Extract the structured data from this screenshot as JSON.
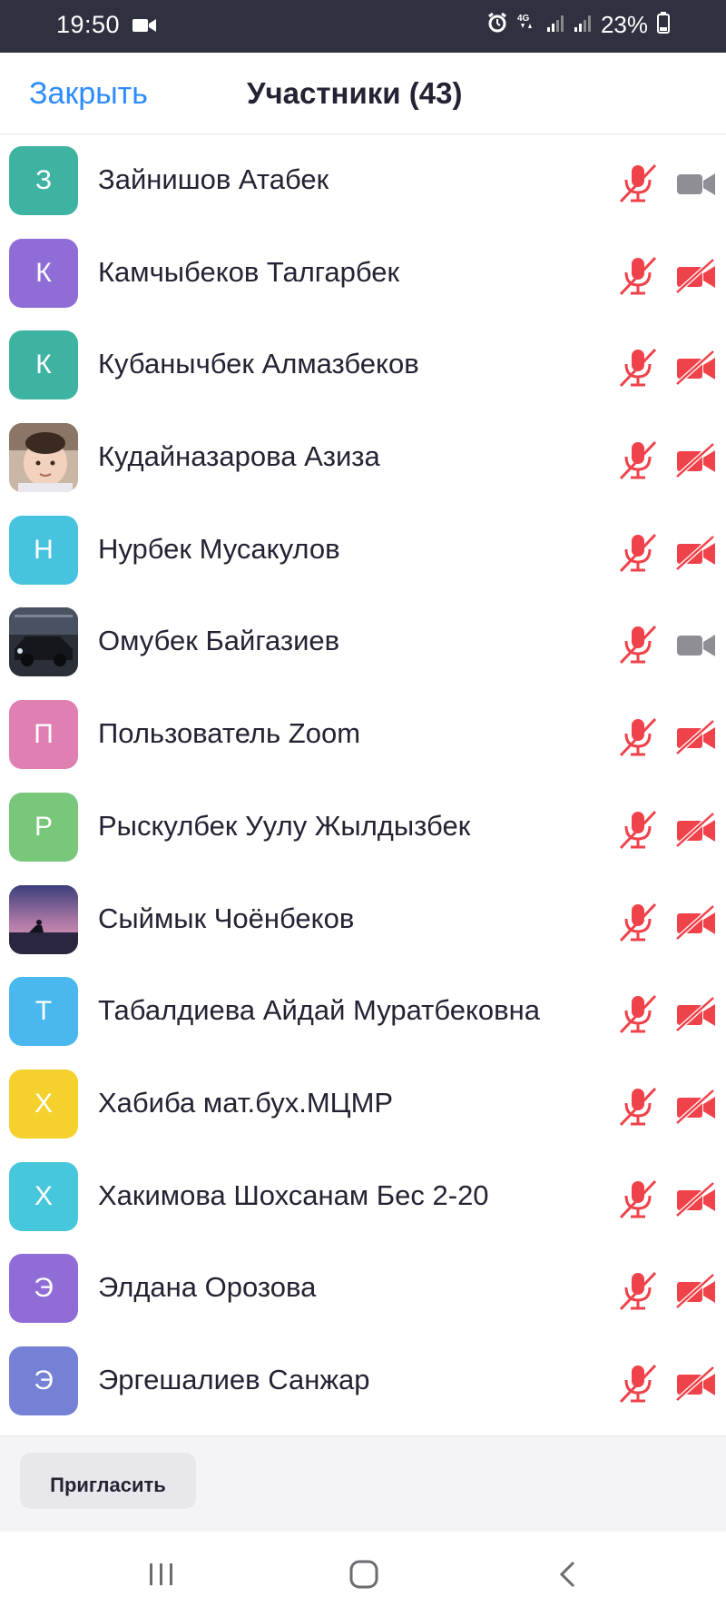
{
  "status_bar": {
    "time": "19:50",
    "battery": "23%",
    "icons": [
      "video-camera-icon",
      "alarm-icon",
      "4g-icon",
      "signal-icon",
      "signal-icon",
      "battery-icon"
    ]
  },
  "header": {
    "close_label": "Закрыть",
    "title": "Участники (43)"
  },
  "colors": {
    "accent": "#2d8cff",
    "muted_red": "#f0424a",
    "video_gray": "#8e8e94",
    "status_bar_bg": "#2f3140"
  },
  "participants": [
    {
      "initial": "З",
      "name": "Зайнишов Атабек",
      "avatar_color": "#3fb3a2",
      "avatar_type": "letter",
      "mic": "muted",
      "video": "on"
    },
    {
      "initial": "К",
      "name": "Камчыбеков Талгарбек",
      "avatar_color": "#8f6cd6",
      "avatar_type": "letter",
      "mic": "muted",
      "video": "off"
    },
    {
      "initial": "К",
      "name": "Кубанычбек Алмазбеков",
      "avatar_color": "#3fb3a2",
      "avatar_type": "letter",
      "mic": "muted",
      "video": "off"
    },
    {
      "initial": "",
      "name": "Кудайназарова Азиза",
      "avatar_color": "#d9c3b0",
      "avatar_type": "photo-baby",
      "mic": "muted",
      "video": "off"
    },
    {
      "initial": "Н",
      "name": "Нурбек Мусакулов",
      "avatar_color": "#47c3e0",
      "avatar_type": "letter",
      "mic": "muted",
      "video": "off"
    },
    {
      "initial": "",
      "name": "Омубек Байгазиев",
      "avatar_color": "#3a3f4a",
      "avatar_type": "photo-car",
      "mic": "muted",
      "video": "on"
    },
    {
      "initial": "П",
      "name": "Пользователь Zoom",
      "avatar_color": "#e07fb1",
      "avatar_type": "letter",
      "mic": "muted",
      "video": "off"
    },
    {
      "initial": "Р",
      "name": "Рыскулбек Уулу Жылдызбек",
      "avatar_color": "#79c77b",
      "avatar_type": "letter",
      "mic": "muted",
      "video": "off"
    },
    {
      "initial": "",
      "name": "Сыймык Чоёнбеков",
      "avatar_color": "#6b5a8c",
      "avatar_type": "photo-sunset",
      "mic": "muted",
      "video": "off"
    },
    {
      "initial": "Т",
      "name": "Табалдиева Айдай Муратбековна",
      "avatar_color": "#4ab7ee",
      "avatar_type": "letter",
      "mic": "muted",
      "video": "off"
    },
    {
      "initial": "Х",
      "name": "Хабиба мат.бух.МЦМР",
      "avatar_color": "#f5d12e",
      "avatar_type": "letter",
      "mic": "muted",
      "video": "off"
    },
    {
      "initial": "Х",
      "name": "Хакимова Шохсанам Бес 2-20",
      "avatar_color": "#47c7dc",
      "avatar_type": "letter",
      "mic": "muted",
      "video": "off"
    },
    {
      "initial": "Э",
      "name": "Элдана Орозова",
      "avatar_color": "#8f6cd6",
      "avatar_type": "letter",
      "mic": "muted",
      "video": "off"
    },
    {
      "initial": "Э",
      "name": "Эргешалиев Санжар",
      "avatar_color": "#7481d4",
      "avatar_type": "letter",
      "mic": "muted",
      "video": "off"
    }
  ],
  "bottom_bar": {
    "invite_label": "Пригласить"
  },
  "nav_bar": {
    "icons": [
      "recents-icon",
      "home-icon",
      "back-icon"
    ]
  }
}
